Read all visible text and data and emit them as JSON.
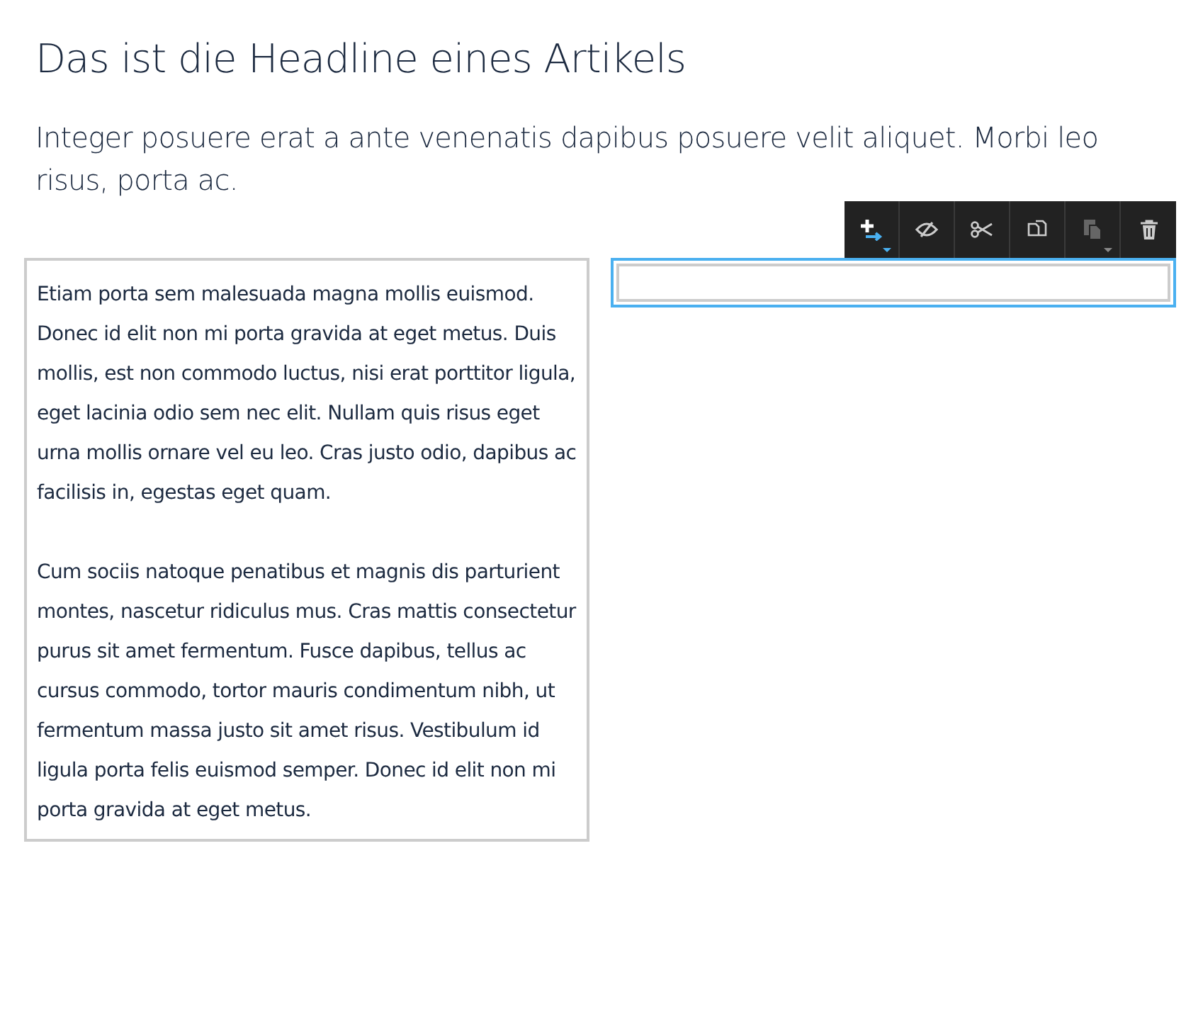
{
  "headline": "Das ist die Headline eines Artikels",
  "subheadline": "Integer posuere erat a ante venenatis dapibus posuere velit aliquet. Morbi leo risus, porta ac.",
  "text_block": {
    "paragraphs": [
      "Etiam porta sem malesuada magna mollis euismod. Donec id elit non mi porta gravida at eget metus. Duis mollis, est non commodo luctus, nisi erat porttitor ligula, eget lacinia odio sem nec elit. Nullam quis risus eget urna mollis ornare vel eu leo. Cras justo odio, dapibus ac facilisis in, egestas eget quam.",
      "Cum sociis natoque penatibus et magnis dis parturient montes, nascetur ridiculus mus. Cras mattis consectetur purus sit amet fermentum. Fusce dapibus, tellus ac cursus commodo, tortor mauris condimentum nibh, ut fermentum massa justo sit amet risus. Vestibulum id ligula porta felis euismod semper. Donec id elit non mi porta gravida at eget metus."
    ]
  },
  "empty_block": {
    "selected": true
  },
  "toolbar": [
    {
      "kind": "add",
      "disabled": false,
      "dropdown": true
    },
    {
      "kind": "hide",
      "disabled": false,
      "dropdown": false
    },
    {
      "kind": "cut",
      "disabled": false,
      "dropdown": false
    },
    {
      "kind": "copy",
      "disabled": false,
      "dropdown": false
    },
    {
      "kind": "paste",
      "disabled": true,
      "dropdown": true
    },
    {
      "kind": "delete",
      "disabled": false,
      "dropdown": false
    }
  ]
}
